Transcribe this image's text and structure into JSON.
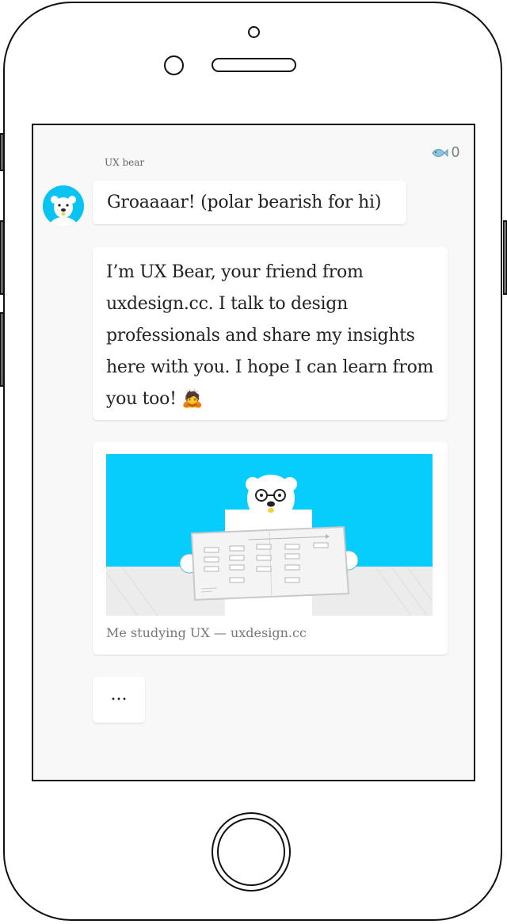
{
  "chat": {
    "sender_name": "UX bear",
    "score": {
      "icon": "fish-icon",
      "value": "0"
    },
    "messages": [
      {
        "text": "Groaaaar! (polar bearish for hi)"
      },
      {
        "text": "I’m UX Bear, your friend from uxdesign.cc. I talk to design professionals and share my insights here with you. I hope I can learn from you too! 🙇"
      },
      {
        "caption": "Me studying UX — uxdesign.cc",
        "image": "bear-reading-sitemap-illustration"
      },
      {
        "text": "..."
      }
    ]
  },
  "colors": {
    "accent_blue": "#06cdfb",
    "screen_bg": "#f8f8f8",
    "bubble_bg": "#ffffff"
  }
}
